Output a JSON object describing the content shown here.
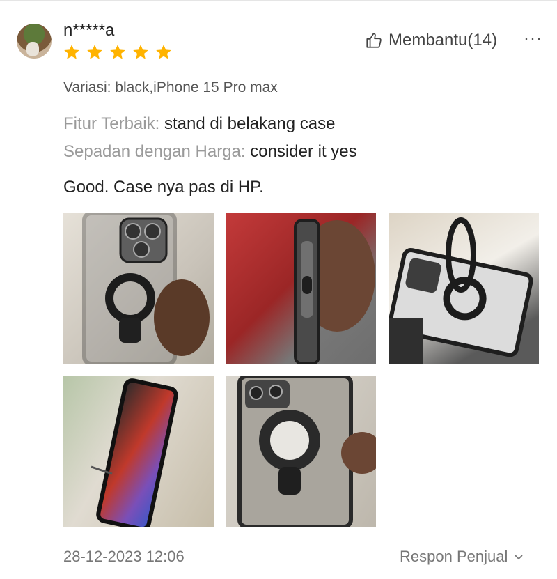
{
  "review": {
    "username": "n*****a",
    "rating": 5,
    "helpful": "Membantu(14)",
    "more": "···",
    "variation": "Variasi: black,iPhone 15 Pro max",
    "fields": [
      {
        "label": "Fitur Terbaik:",
        "value": "stand di belakang case"
      },
      {
        "label": "Sepadan dengan Harga:",
        "value": "consider it yes"
      }
    ],
    "comment": "Good. Case nya pas di HP.",
    "date": "28-12-2023 12:06",
    "seller_response": "Respon Penjual"
  },
  "colors": {
    "star": "#ffb300",
    "text": "#222222",
    "muted": "#9a9a9a"
  },
  "icons": {
    "helpful": "thumbs-up-icon",
    "more": "more-options-icon",
    "expand": "chevron-down-icon"
  }
}
